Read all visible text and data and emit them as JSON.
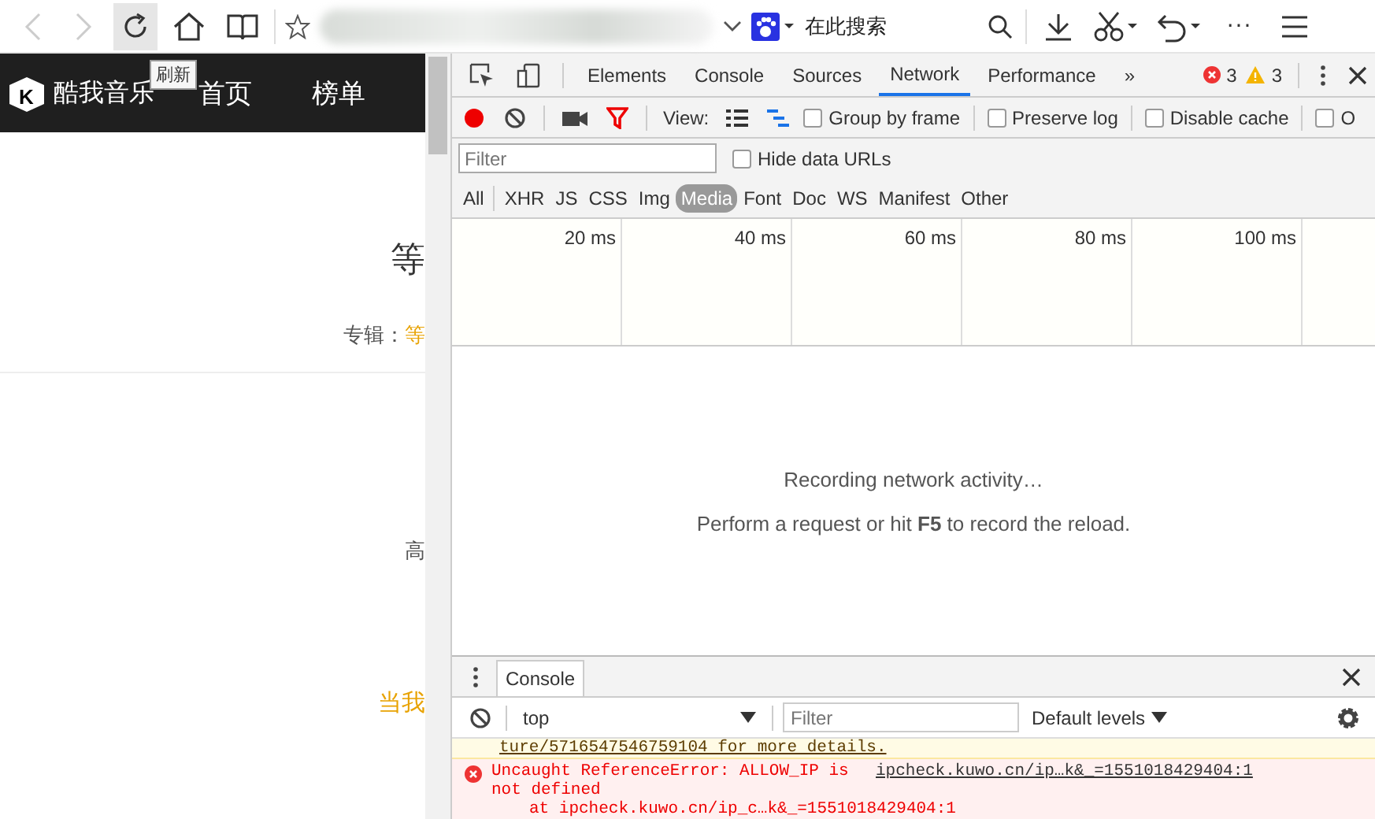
{
  "browser_toolbar": {
    "back_disabled": true,
    "forward_disabled": true,
    "search_placeholder": "在此搜索",
    "more": "···",
    "refresh_tooltip": "刷新"
  },
  "page": {
    "logo_mark": "K",
    "logo": "酷我音乐",
    "nav": [
      "首页",
      "榜单"
    ],
    "title": "等",
    "album_label": "专辑：",
    "album_value": "等",
    "quality": "高",
    "lyric": "当我"
  },
  "devtools": {
    "tabs": [
      {
        "label": "Elements",
        "selected": false
      },
      {
        "label": "Console",
        "selected": false
      },
      {
        "label": "Sources",
        "selected": false
      },
      {
        "label": "Network",
        "selected": true
      },
      {
        "label": "Performance",
        "selected": false
      }
    ],
    "more_tabs": "»",
    "errors": "3",
    "warnings": "3",
    "network_toolbar": {
      "recording": true,
      "view_label": "View:",
      "options": [
        {
          "label": "Group by frame",
          "checked": false
        },
        {
          "label": "Preserve log",
          "checked": false
        },
        {
          "label": "Disable cache",
          "checked": false
        },
        {
          "label": "O",
          "checked": false
        }
      ]
    },
    "filter": {
      "placeholder": "Filter"
    },
    "hide_data_urls": {
      "label": "Hide data URLs",
      "checked": false
    },
    "types": [
      {
        "label": "All",
        "selected": false
      },
      {
        "label": "XHR",
        "selected": false
      },
      {
        "label": "JS",
        "selected": false
      },
      {
        "label": "CSS",
        "selected": false
      },
      {
        "label": "Img",
        "selected": false
      },
      {
        "label": "Media",
        "selected": true
      },
      {
        "label": "Font",
        "selected": false
      },
      {
        "label": "Doc",
        "selected": false
      },
      {
        "label": "WS",
        "selected": false
      },
      {
        "label": "Manifest",
        "selected": false
      },
      {
        "label": "Other",
        "selected": false
      }
    ],
    "timeline_ticks": [
      "20 ms",
      "40 ms",
      "60 ms",
      "80 ms",
      "100 ms"
    ],
    "empty_message": "Recording network activity…",
    "hint": "Perform a request or hit **F5** to record the reload.",
    "drawer": {
      "tab": "Console",
      "context": "top",
      "filter_placeholder": "Filter",
      "levels": "Default levels",
      "messages": [
        {
          "kind": "warning",
          "text": "ture/5716547546759104 for more details."
        },
        {
          "kind": "error",
          "text": "Uncaught ReferenceError: ALLOW_IP is not defined",
          "source": "ipcheck.kuwo.cn/ip…k&_=1551018429404:1",
          "stack": "at ipcheck.kuwo.cn/ip_c…k&_=1551018429404:1"
        }
      ]
    }
  }
}
